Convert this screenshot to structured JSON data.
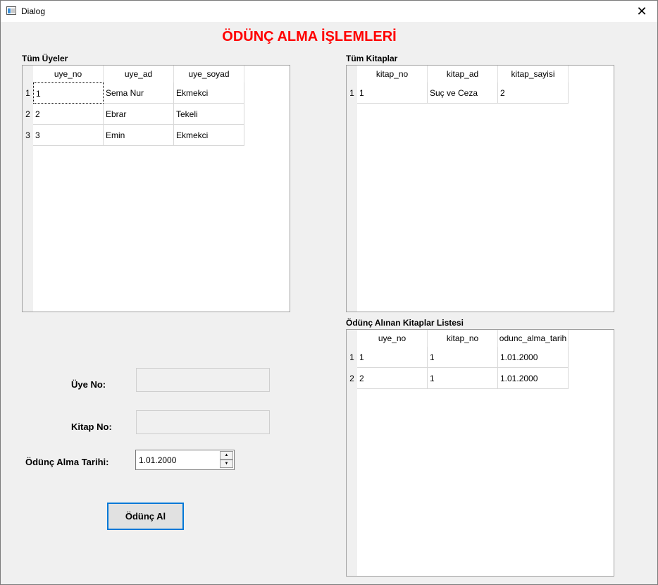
{
  "window": {
    "title": "Dialog",
    "close_label": "✕"
  },
  "heading": "ÖDÜNÇ ALMA İŞLEMLERİ",
  "members": {
    "label": "Tüm Üyeler",
    "columns": [
      "uye_no",
      "uye_ad",
      "uye_soyad"
    ],
    "row_numbers": [
      "1",
      "2",
      "3"
    ],
    "rows": [
      [
        "1",
        "Sema Nur",
        "Ekmekci"
      ],
      [
        "2",
        "Ebrar",
        "Tekeli"
      ],
      [
        "3",
        "Emin",
        "Ekmekci"
      ]
    ]
  },
  "books": {
    "label": "Tüm Kitaplar",
    "columns": [
      "kitap_no",
      "kitap_ad",
      "kitap_sayisi"
    ],
    "row_numbers": [
      "1"
    ],
    "rows": [
      [
        "1",
        "Suç ve Ceza",
        "2"
      ]
    ]
  },
  "borrowed": {
    "label": "Ödünç Alınan Kitaplar Listesi",
    "columns": [
      "uye_no",
      "kitap_no",
      "odunc_alma_tarih"
    ],
    "row_numbers": [
      "1",
      "2"
    ],
    "rows": [
      [
        "1",
        "1",
        "1.01.2000"
      ],
      [
        "2",
        "1",
        "1.01.2000"
      ]
    ]
  },
  "form": {
    "member_no_label": "Üye No:",
    "book_no_label": "Kitap No:",
    "date_label": "Ödünç Alma Tarihi:",
    "date_value": "1.01.2000",
    "submit_label": "Ödünç Al"
  }
}
